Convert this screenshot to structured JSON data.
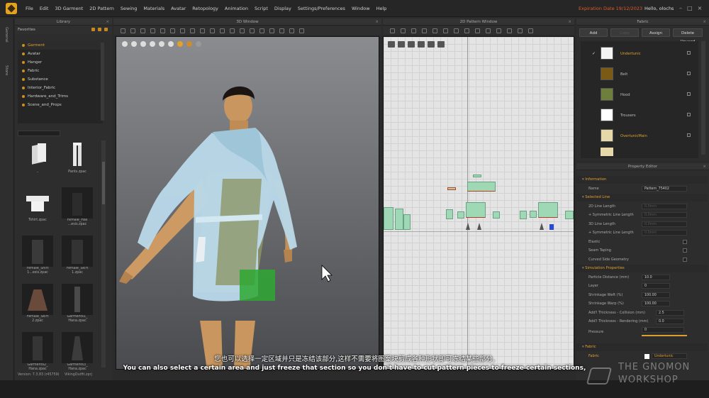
{
  "menubar": {
    "items": [
      "File",
      "Edit",
      "3D Garment",
      "2D Pattern",
      "Sewing",
      "Materials",
      "Avatar",
      "Retopology",
      "Animation",
      "Script",
      "Display",
      "Settings/Preferences",
      "Window",
      "Help"
    ],
    "expiration": "Expiration Date 19/12/2023",
    "user": "Hello, olochs"
  },
  "sidebar_tabs": [
    "General",
    "Store"
  ],
  "library": {
    "title": "Library",
    "favorites_label": "Favorites",
    "tree": [
      "Garment",
      "Avatar",
      "Hanger",
      "Fabric",
      "Substance",
      "Interior_Fabric",
      "Hardware_and_Trims",
      "Scene_and_Props"
    ],
    "selected": "Garment",
    "thumbnails": [
      {
        "caption": "..",
        "kind": "folder"
      },
      {
        "caption": "Pants.zpac",
        "kind": "pants"
      },
      {
        "caption": "Tshirt.zpac",
        "kind": "tshirt"
      },
      {
        "caption": "Female_Hali ...esis.zpac",
        "kind": "dark"
      },
      {
        "caption": "Female_Shirt 1...esis.zpac",
        "kind": "dress"
      },
      {
        "caption": "Female_Skirt 1.zpac",
        "kind": "dark"
      },
      {
        "caption": "Female_Skirt 2.zpac",
        "kind": "skirt"
      },
      {
        "caption": "Garments1_ Hana.zpac",
        "kind": "avatar"
      },
      {
        "caption": "Garments2_ Hana.zpac",
        "kind": "dark"
      },
      {
        "caption": "Garments3_ Hana.zpac",
        "kind": "dress"
      }
    ],
    "version_label": "Version:",
    "version_value": "7.3.83 (r45759)",
    "file_name": "VikingOutfit.zprj"
  },
  "window3d": {
    "title": "3D Window"
  },
  "window2d": {
    "title": "2D Pattern Window"
  },
  "fabric_panel": {
    "title": "Fabric",
    "buttons": [
      "Add",
      "Copy",
      "Assign",
      "Delete Unused"
    ],
    "items": [
      {
        "name": "Undertunic",
        "color": "#f4f4f4",
        "checked": true,
        "highlight": true
      },
      {
        "name": "Belt",
        "color": "#7a5a14",
        "checked": false,
        "highlight": false
      },
      {
        "name": "Hood",
        "color": "#6e7e3c",
        "checked": false,
        "highlight": false
      },
      {
        "name": "Trousers",
        "color": "#ffffff",
        "checked": false,
        "highlight": false
      },
      {
        "name": "OvertunicMain",
        "color": "#e6d8a8",
        "checked": false,
        "highlight": true
      }
    ]
  },
  "property_editor": {
    "title": "Property Editor",
    "sections": {
      "information": "Information",
      "selected_line": "Selected Line",
      "simulation": "Simulation Properties",
      "fabric": "Fabric"
    },
    "name_label": "Name",
    "name_value": "Pattern_75402",
    "line_2d_length": "2D Line Length",
    "sym_line_length": "+ Symmetric Line Length",
    "line_3d_length": "3D Line Length",
    "sym_line_length_3d": "+ Symmetric Line Length",
    "line_values": [
      "0.0mm",
      "0.0mm",
      "0.0mm",
      "0.0mm"
    ],
    "elastic": "Elastic",
    "seam_taping": "Seam Taping",
    "curved_side": "Curved Side Geometry",
    "particle_distance_label": "Particle Distance (mm)",
    "particle_distance": "10.0",
    "layer_label": "Layer",
    "layer": "0",
    "shrink_weft_label": "Shrinkage Weft (%)",
    "shrink_weft": "100.00",
    "shrink_warp_label": "Shrinkage Warp (%)",
    "shrink_warp": "100.00",
    "collision_label": "Add'l Thickness - Collision (mm)",
    "collision": "2.5",
    "rendering_label": "Add'l Thickness - Rendering (mm)",
    "rendering": "0.0",
    "pressure_label": "Pressure",
    "pressure": "0",
    "fabric_label": "Fabric",
    "fabric_value": "Undertunic"
  },
  "subtitles": {
    "chinese": "您也可以选择一定区域并只是冻结该部分,这样不需要将图案块剪成各种形状即可冻结某些部分,",
    "english": "You can also select a certain area and just freeze that section so you don't have to cut pattern pieces to freeze certain sections,"
  },
  "watermark": {
    "line1": "THE GNOMON",
    "line2": "WORKSHOP"
  }
}
